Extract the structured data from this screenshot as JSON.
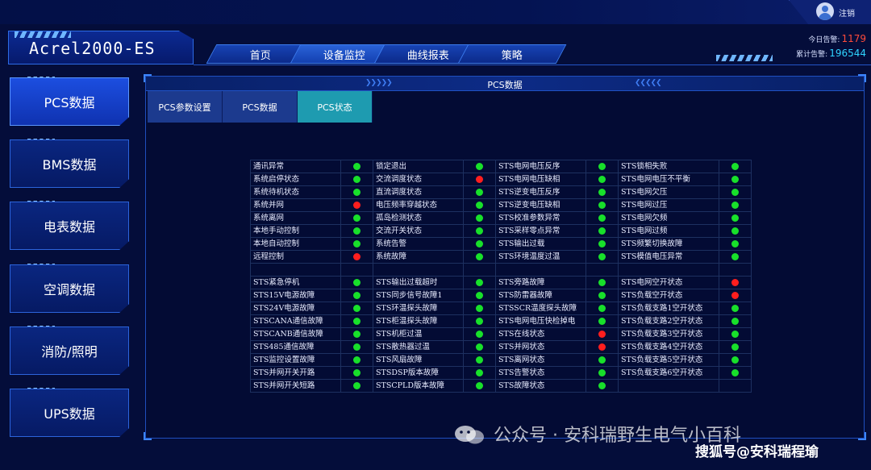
{
  "topbar": {
    "logout_label": "注销"
  },
  "header": {
    "app_title": "Acrel2000-ES",
    "nav": [
      "首页",
      "设备监控",
      "曲线报表",
      "策略"
    ],
    "alarms": {
      "today_label": "今日告警:",
      "today_value": "1179",
      "total_label": "累计告警:",
      "total_value": "196544"
    }
  },
  "sidebar": {
    "items": [
      "PCS数据",
      "BMS数据",
      "电表数据",
      "空调数据",
      "消防/照明",
      "UPS数据"
    ],
    "active": 0
  },
  "panel": {
    "title": "PCS数据",
    "tabs": [
      "PCS参数设置",
      "PCS数据",
      "PCS状态"
    ],
    "active_tab": 2
  },
  "status_rows": [
    [
      [
        "通讯异常",
        "ok"
      ],
      [
        "锁定退出",
        "ok"
      ],
      [
        "STS电网电压反序",
        "ok"
      ],
      [
        "STS锁相失败",
        "ok"
      ]
    ],
    [
      [
        "系统启停状态",
        "ok"
      ],
      [
        "交流调度状态",
        "bad"
      ],
      [
        "STS电网电压缺相",
        "ok"
      ],
      [
        "STS电网电压不平衡",
        "ok"
      ]
    ],
    [
      [
        "系统待机状态",
        "ok"
      ],
      [
        "直流调度状态",
        "ok"
      ],
      [
        "STS逆变电压反序",
        "ok"
      ],
      [
        "STS电网欠压",
        "ok"
      ]
    ],
    [
      [
        "系统并网",
        "bad"
      ],
      [
        "电压频率穿越状态",
        "ok"
      ],
      [
        "STS逆变电压缺相",
        "ok"
      ],
      [
        "STS电网过压",
        "ok"
      ]
    ],
    [
      [
        "系统离网",
        "ok"
      ],
      [
        "孤岛检测状态",
        "ok"
      ],
      [
        "STS校准参数异常",
        "ok"
      ],
      [
        "STS电网欠频",
        "ok"
      ]
    ],
    [
      [
        "本地手动控制",
        "ok"
      ],
      [
        "交流开关状态",
        "ok"
      ],
      [
        "STS采样零点异常",
        "ok"
      ],
      [
        "STS电网过频",
        "ok"
      ]
    ],
    [
      [
        "本地自动控制",
        "ok"
      ],
      [
        "系统告警",
        "ok"
      ],
      [
        "STS输出过载",
        "ok"
      ],
      [
        "STS频繁切换故障",
        "ok"
      ]
    ],
    [
      [
        "远程控制",
        "bad"
      ],
      [
        "系统故障",
        "ok"
      ],
      [
        "STS环境温度过温",
        "ok"
      ],
      [
        "STS模值电压异常",
        "ok"
      ]
    ],
    [
      [
        "",
        ""
      ],
      [
        "",
        ""
      ],
      [
        "",
        ""
      ],
      [
        "",
        ""
      ]
    ],
    [
      [
        "STS紧急停机",
        "ok"
      ],
      [
        "STS输出过载超时",
        "ok"
      ],
      [
        "STS旁路故障",
        "ok"
      ],
      [
        "STS电网空开状态",
        "bad"
      ]
    ],
    [
      [
        "STS15V电源故障",
        "ok"
      ],
      [
        "STS同步信号故障1",
        "ok"
      ],
      [
        "STS防雷器故障",
        "ok"
      ],
      [
        "STS负载空开状态",
        "bad"
      ]
    ],
    [
      [
        "STS24V电源故障",
        "ok"
      ],
      [
        "STS环温探头故障",
        "ok"
      ],
      [
        "STSSCR温度探头故障",
        "ok"
      ],
      [
        "STS负载支路1空开状态",
        "ok"
      ]
    ],
    [
      [
        "STSCANA通信故障",
        "ok"
      ],
      [
        "STS柜温探头故障",
        "ok"
      ],
      [
        "STS电网电压快检掉电",
        "ok"
      ],
      [
        "STS负载支路2空开状态",
        "ok"
      ]
    ],
    [
      [
        "STSCANB通信故障",
        "ok"
      ],
      [
        "STS机柜过温",
        "ok"
      ],
      [
        "STS在线状态",
        "bad"
      ],
      [
        "STS负载支路3空开状态",
        "ok"
      ]
    ],
    [
      [
        "STS485通信故障",
        "ok"
      ],
      [
        "STS散热器过温",
        "ok"
      ],
      [
        "STS并网状态",
        "bad"
      ],
      [
        "STS负载支路4空开状态",
        "ok"
      ]
    ],
    [
      [
        "STS监控设置故障",
        "ok"
      ],
      [
        "STS风扇故障",
        "ok"
      ],
      [
        "STS离网状态",
        "ok"
      ],
      [
        "STS负载支路5空开状态",
        "ok"
      ]
    ],
    [
      [
        "STS并网开关开路",
        "ok"
      ],
      [
        "STSDSP版本故障",
        "ok"
      ],
      [
        "STS告警状态",
        "ok"
      ],
      [
        "STS负载支路6空开状态",
        "ok"
      ]
    ],
    [
      [
        "STS并网开关短路",
        "ok"
      ],
      [
        "STSCPLD版本故障",
        "ok"
      ],
      [
        "STS故障状态",
        "ok"
      ],
      [
        "",
        ""
      ]
    ]
  ],
  "watermarks": {
    "line1": "公众号 · 安科瑞野生电气小百科",
    "line2": "搜狐号@安科瑞程瑜"
  },
  "colors": {
    "ok": "#18e02a",
    "bad": "#ff1e1e",
    "active_tab": "#1e9bb0"
  }
}
